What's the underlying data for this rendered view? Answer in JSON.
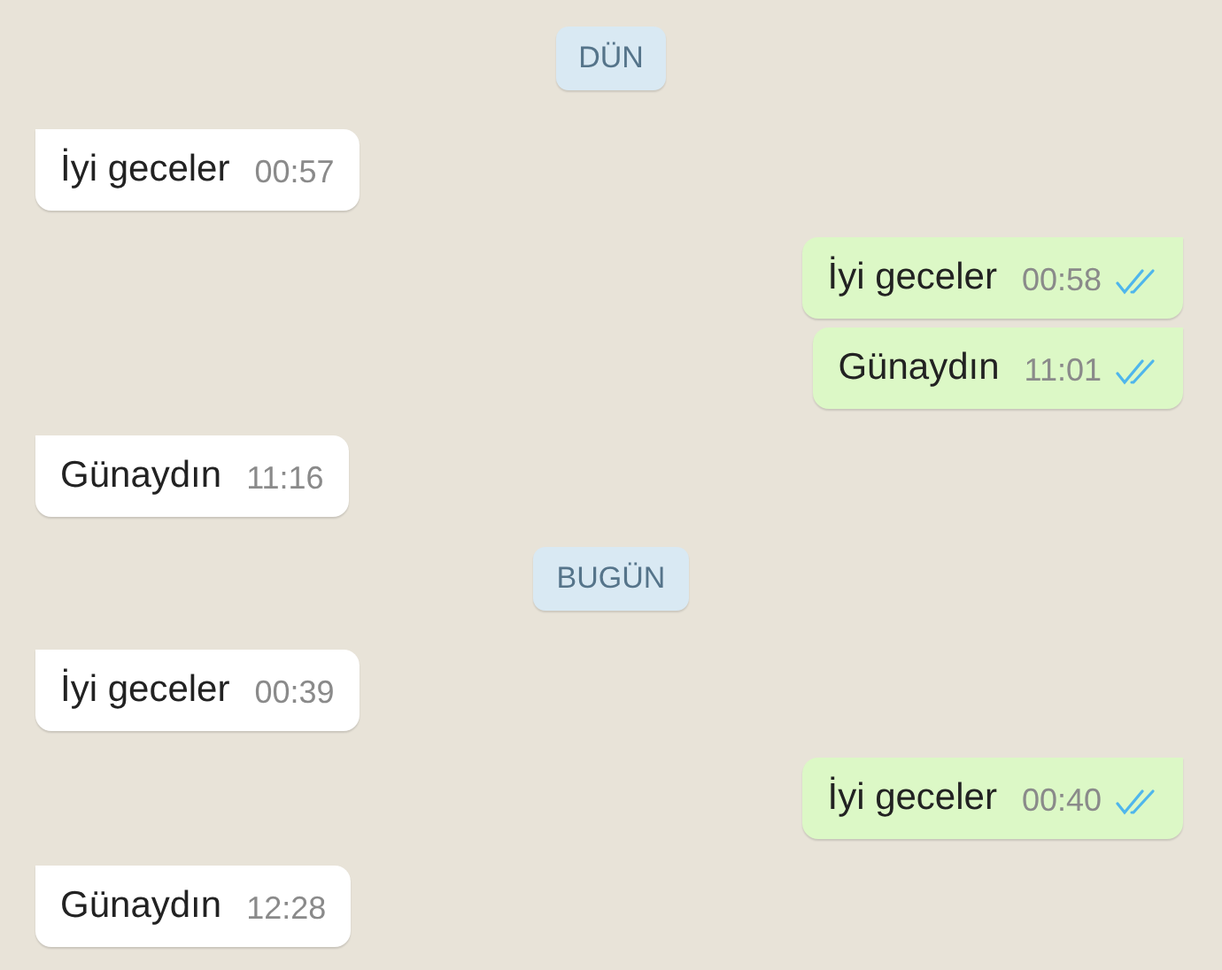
{
  "messages": [
    {
      "kind": "date",
      "text": "DÜN"
    },
    {
      "kind": "message",
      "sent": false,
      "text": "İyi geceler",
      "time": "00:57"
    },
    {
      "kind": "message",
      "sent": true,
      "text": "İyi geceler",
      "time": "00:58",
      "read": true
    },
    {
      "kind": "message",
      "sent": true,
      "text": "Günaydın",
      "time": "11:01",
      "read": true
    },
    {
      "kind": "message",
      "sent": false,
      "text": "Günaydın",
      "time": "11:16"
    },
    {
      "kind": "date",
      "text": "BUGÜN"
    },
    {
      "kind": "message",
      "sent": false,
      "text": "İyi geceler",
      "time": "00:39"
    },
    {
      "kind": "message",
      "sent": true,
      "text": "İyi geceler",
      "time": "00:40",
      "read": true
    },
    {
      "kind": "message",
      "sent": false,
      "text": "Günaydın",
      "time": "12:28"
    }
  ]
}
